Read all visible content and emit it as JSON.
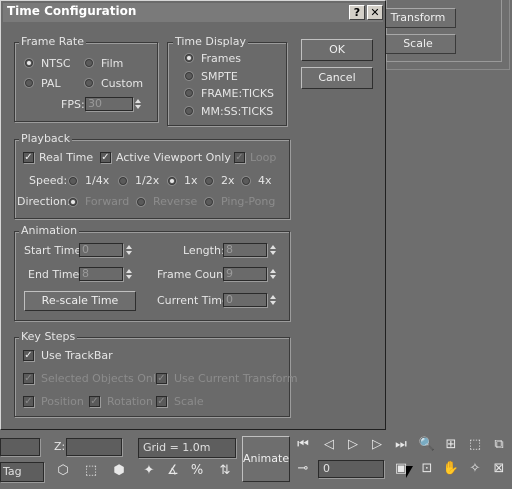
{
  "background_panel": {
    "transform_button": "Transform",
    "scale_button": "Scale"
  },
  "dialog": {
    "title": "Time Configuration",
    "help_button": "?",
    "close_button": "✕",
    "ok_button": "OK",
    "cancel_button": "Cancel",
    "frame_rate": {
      "label": "Frame Rate",
      "options": [
        {
          "label": "NTSC",
          "selected": true
        },
        {
          "label": "Film",
          "selected": false
        },
        {
          "label": "PAL",
          "selected": false
        },
        {
          "label": "Custom",
          "selected": false
        }
      ],
      "fps_label": "FPS:",
      "fps_value": "30"
    },
    "time_display": {
      "label": "Time Display",
      "options": [
        {
          "label": "Frames",
          "selected": true
        },
        {
          "label": "SMPTE",
          "selected": false
        },
        {
          "label": "FRAME:TICKS",
          "selected": false
        },
        {
          "label": "MM:SS:TICKS",
          "selected": false
        }
      ]
    },
    "playback": {
      "label": "Playback",
      "real_time": "Real Time",
      "active_viewport_only": "Active Viewport Only",
      "loop": "Loop",
      "speed_label": "Speed:",
      "speeds": [
        {
          "label": "1/4x",
          "selected": false
        },
        {
          "label": "1/2x",
          "selected": false
        },
        {
          "label": "1x",
          "selected": true
        },
        {
          "label": "2x",
          "selected": false
        },
        {
          "label": "4x",
          "selected": false
        }
      ],
      "direction_label": "Direction:",
      "directions": [
        {
          "label": "Forward",
          "selected": true
        },
        {
          "label": "Reverse",
          "selected": false
        },
        {
          "label": "Ping-Pong",
          "selected": false
        }
      ]
    },
    "animation": {
      "label": "Animation",
      "start_time_label": "Start Time:",
      "start_time_value": "0",
      "length_label": "Length:",
      "length_value": "8",
      "end_time_label": "End Time:",
      "end_time_value": "8",
      "frame_count_label": "Frame Count:",
      "frame_count_value": "9",
      "rescale_button": "Re-scale Time",
      "current_time_label": "Current Time:",
      "current_time_value": "0"
    },
    "key_steps": {
      "label": "Key Steps",
      "use_trackbar": "Use TrackBar",
      "selected_objects_only": "Selected Objects Only",
      "use_current_transform": "Use Current Transform",
      "position": "Position",
      "rotation": "Rotation",
      "scale": "Scale"
    }
  },
  "toolbar": {
    "z_label": "Z:",
    "grid_label": "Grid = 1.0m",
    "animate_button": "Animate",
    "frame_value": "0",
    "tag_label": "Tag"
  }
}
